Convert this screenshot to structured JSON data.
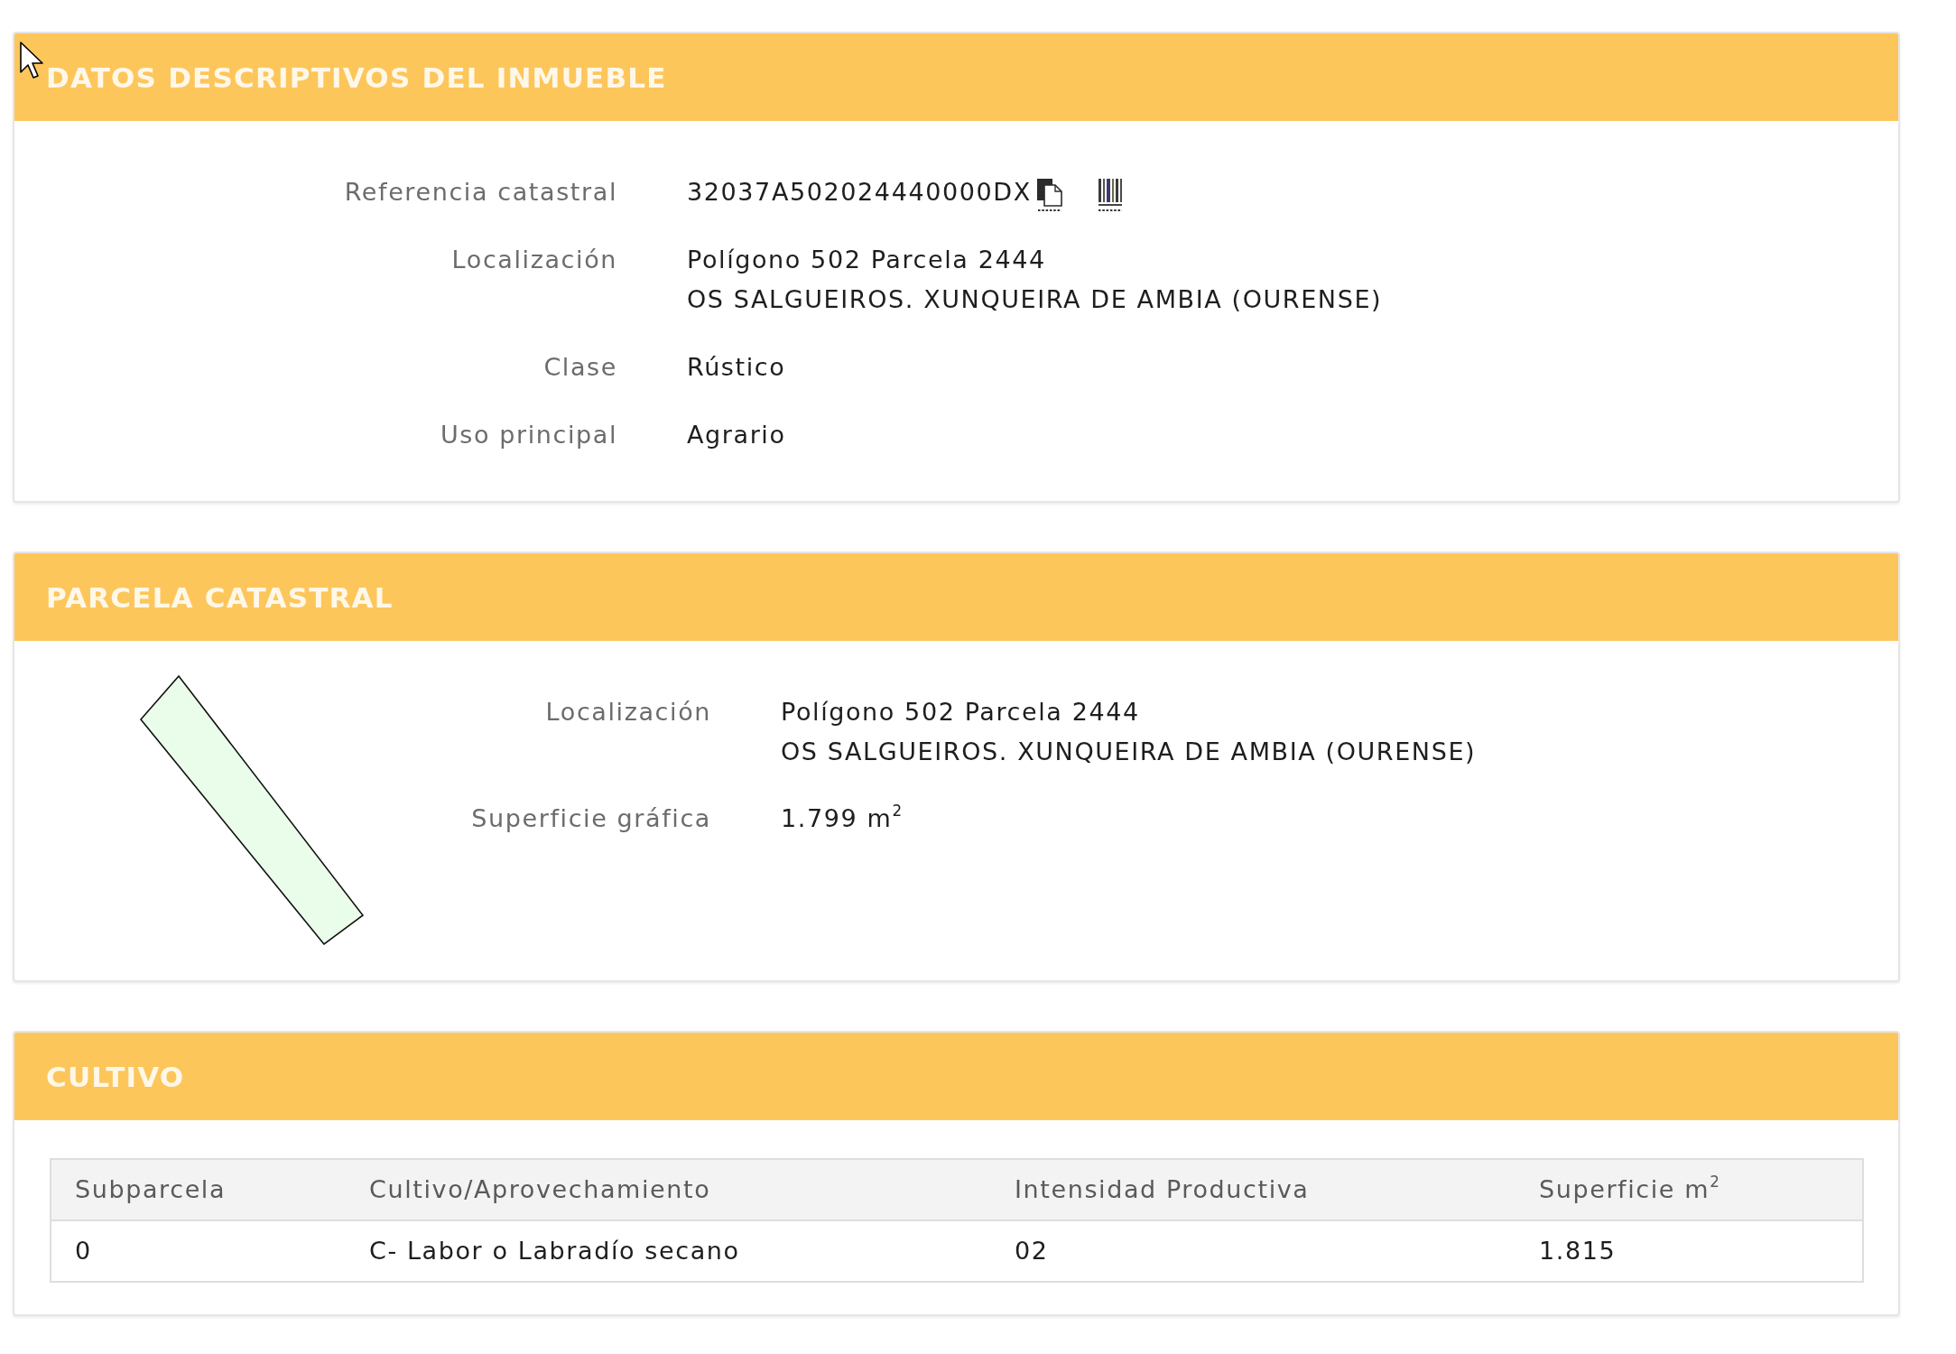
{
  "sections": [
    {
      "kind": "details",
      "title": "DATOS DESCRIPTIVOS DEL INMUEBLE",
      "fields": [
        {
          "kind": "reference",
          "label": "Referencia catastral",
          "lines": [
            "32037A502024440000DX"
          ]
        },
        {
          "kind": "text",
          "label": "Localización",
          "lines": [
            "Polígono 502 Parcela 2444",
            "OS SALGUEIROS. XUNQUEIRA DE AMBIA (OURENSE)"
          ]
        },
        {
          "kind": "text",
          "label": "Clase",
          "lines": [
            "Rústico"
          ]
        },
        {
          "kind": "text",
          "label": "Uso principal",
          "lines": [
            "Agrario"
          ]
        }
      ]
    },
    {
      "kind": "parcel",
      "title": "PARCELA CATASTRAL",
      "fields": [
        {
          "kind": "text",
          "label": "Localización",
          "lines": [
            "Polígono 502 Parcela 2444",
            "OS SALGUEIROS. XUNQUEIRA DE AMBIA (OURENSE)"
          ]
        },
        {
          "kind": "text",
          "label": "Superficie gráfica",
          "lines": [
            "1.799 m$^{2}$"
          ]
        }
      ]
    },
    {
      "kind": "table",
      "title": "CULTIVO",
      "table": {
        "columns": [
          "Subparcela",
          "Cultivo/Aprovechamiento",
          "Intensidad Productiva",
          "Superficie m$^{2}$"
        ],
        "rows": [
          [
            "0",
            "C- Labor o Labradío secano",
            "02",
            "1.815"
          ]
        ]
      }
    }
  ]
}
